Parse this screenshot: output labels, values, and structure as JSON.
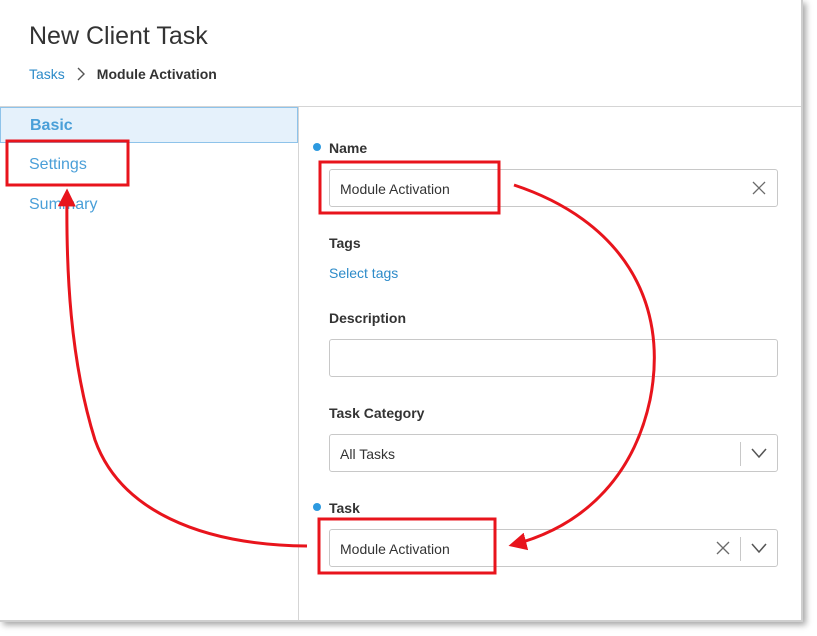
{
  "header": {
    "title": "New Client Task",
    "breadcrumb": {
      "parent": "Tasks",
      "current": "Module Activation"
    }
  },
  "sidebar": {
    "items": [
      {
        "label": "Basic",
        "active": true
      },
      {
        "label": "Settings",
        "active": false
      },
      {
        "label": "Summary",
        "active": false
      }
    ]
  },
  "form": {
    "name": {
      "label": "Name",
      "value": "Module Activation",
      "required": true
    },
    "tags": {
      "label": "Tags",
      "link": "Select tags"
    },
    "description": {
      "label": "Description",
      "value": ""
    },
    "task_category": {
      "label": "Task Category",
      "value": "All Tasks"
    },
    "task": {
      "label": "Task",
      "value": "Module Activation",
      "required": true
    }
  },
  "colors": {
    "accent": "#2d8bc9",
    "nav_text": "#4a9fd8",
    "active_bg": "#e5f1fb",
    "required_dot": "#2d9ae0",
    "annotation": "#e8141c"
  },
  "icons": {
    "breadcrumb_separator": "chevron-right-icon",
    "clear": "close-icon",
    "dropdown": "chevron-down-icon"
  }
}
